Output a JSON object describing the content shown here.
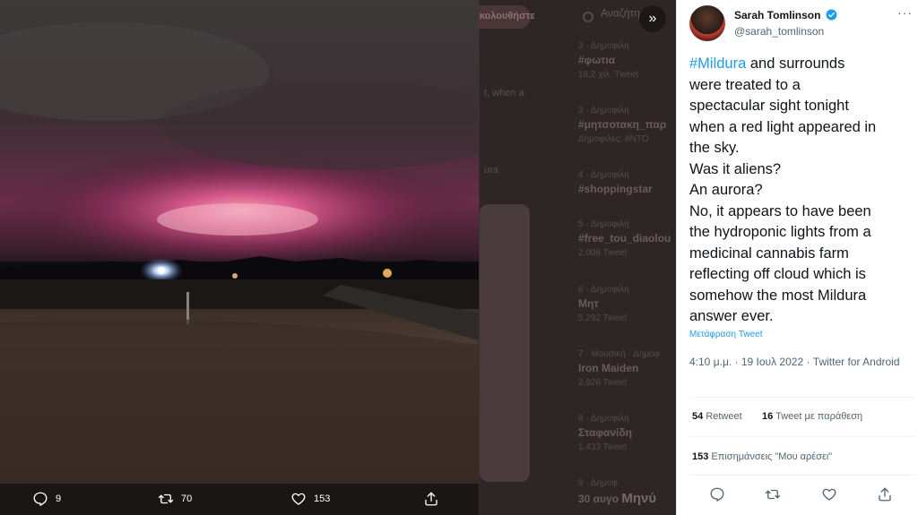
{
  "backdrop": {
    "follow_label": "ακολουθήστε",
    "search_placeholder": "Αναζήτηση",
    "snippet_1": "t, when a",
    "snippet_2": "ura",
    "trends": [
      {
        "meta": "3 · Δημοφιλή",
        "tag": "#φωτια",
        "count": "18,2 χιλ. Tweet"
      },
      {
        "meta": "3 · Δημοφιλή",
        "tag": "#μητσοτακη_παρ",
        "count": "Δημοφιλές: #ΝΤΟ"
      },
      {
        "meta": "4 · Δημοφιλή",
        "tag": "#shoppingstar",
        "count": ""
      },
      {
        "meta": "5 · Δημοφιλή",
        "tag": "#free_tou_diaolou",
        "count": "2.008 Tweet"
      },
      {
        "meta": "6 · Δημοφιλή",
        "tag": "Μητ",
        "count": "5.292 Tweet"
      },
      {
        "meta": "7 · Μουσική · Δημοφ",
        "tag": "Iron Maiden",
        "count": "2.926 Tweet"
      },
      {
        "meta": "8 · Δημοφιλή",
        "tag": "Σταφανίδη",
        "count": "1.433 Tweet"
      },
      {
        "meta": "9 · Δημοφ",
        "tag": "30 αυγο",
        "count": ""
      }
    ],
    "messages_label": "Μηνύ"
  },
  "media_actions": {
    "reply_count": "9",
    "retweet_count": "70",
    "like_count": "153"
  },
  "tweet": {
    "author_name": "Sarah Tomlinson",
    "handle": "@sarah_tomlinson",
    "more_label": "···",
    "hashtag": "#Mildura",
    "text_lines": [
      " and surrounds",
      "were treated to a",
      "spectacular sight tonight",
      "when a red light appeared in",
      "the sky.",
      "Was it aliens?",
      "An aurora?",
      "No, it appears to have been",
      "the hydroponic lights from a",
      "medicinal cannabis farm",
      "reflecting off cloud which is",
      "somehow the most Mildura",
      "answer ever."
    ],
    "translate_label": "Μετάφραση Tweet",
    "timestamp": "4:10 μ.μ. · 19 Ιουλ 2022 · Twitter for Android",
    "retweets_count": "54",
    "retweets_label": "Retweet",
    "quotes_count": "16",
    "quotes_label": "Tweet με παράθεση",
    "likes_count": "153",
    "likes_label": "Επισημάνσεις \"Μου αρέσει\""
  },
  "colors": {
    "accent": "#1d9bf0",
    "sky_glow": "#d0507a",
    "panel_bg": "#ffffff"
  },
  "icons": [
    "reply-icon",
    "retweet-icon",
    "like-icon",
    "share-icon",
    "verified-icon",
    "collapse-panel-icon",
    "more-icon"
  ]
}
